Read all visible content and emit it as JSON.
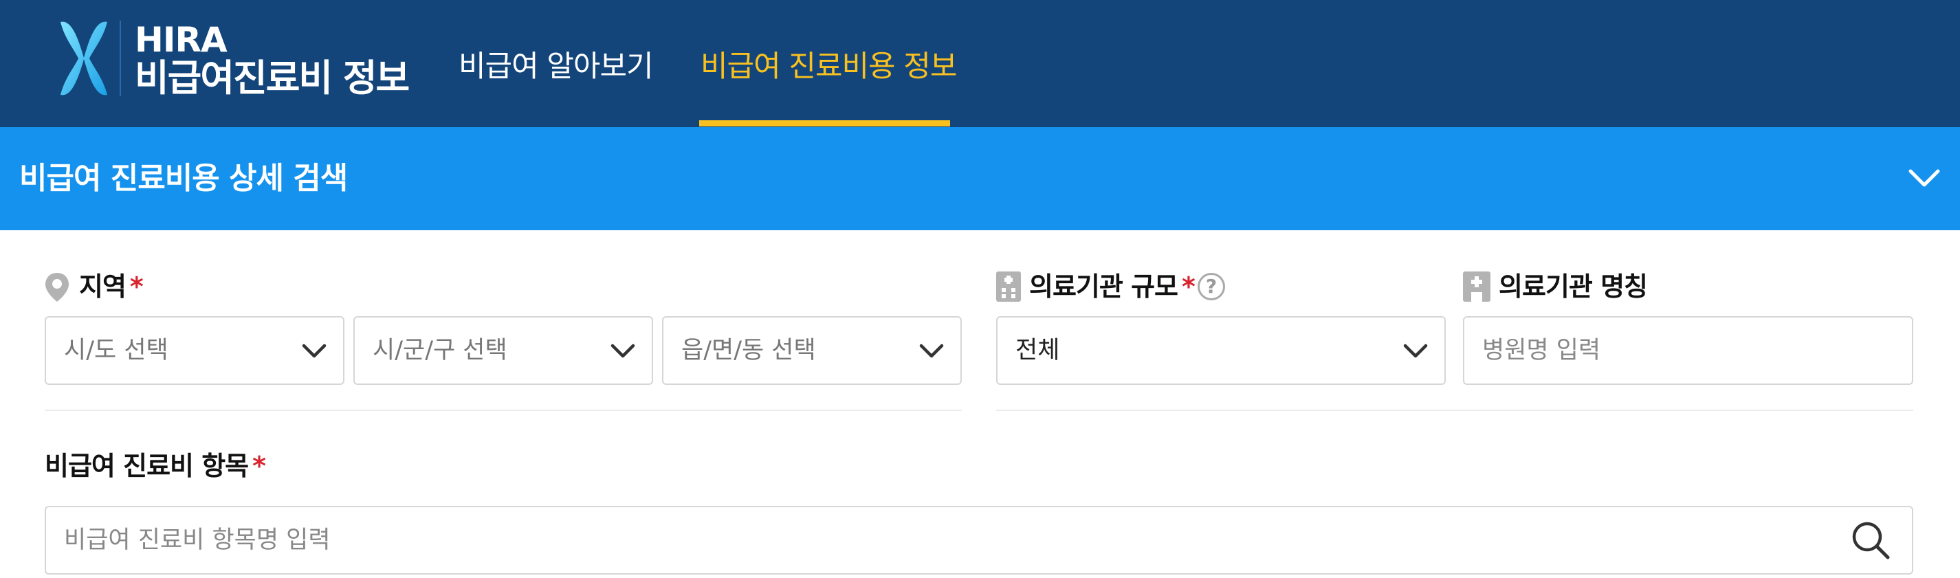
{
  "header": {
    "logo_title": "HIRA",
    "logo_subtitle": "비급여진료비 정보",
    "nav": [
      {
        "label": "비급여 알아보기",
        "active": false
      },
      {
        "label": "비급여 진료비용 정보",
        "active": true
      }
    ]
  },
  "search_panel": {
    "title": "비급여 진료비용 상세 검색",
    "toggle_icon": "chevron-down-icon"
  },
  "region": {
    "label": "지역",
    "required_mark": "*",
    "icon": "map-pin-icon",
    "selects": [
      {
        "selected": "시/도 선택"
      },
      {
        "selected": "시/군/구 선택"
      },
      {
        "selected": "읍/면/동 선택"
      }
    ]
  },
  "institution_scale": {
    "label": "의료기관 규모",
    "required_mark": "*",
    "icon": "hospital-building-icon",
    "help_icon": "help-icon",
    "help_glyph": "?",
    "selected": "전체"
  },
  "institution_name": {
    "label": "의료기관 명칭",
    "icon": "hospital-cross-icon",
    "placeholder": "병원명 입력",
    "value": ""
  },
  "item": {
    "label": "비급여 진료비 항목",
    "required_mark": "*",
    "placeholder": "비급여 진료비 항목명 입력",
    "value": "",
    "search_icon": "search-icon"
  },
  "colors": {
    "header_bg": "#13457a",
    "accent_yellow": "#f9c11f",
    "search_bar_bg": "#1592ee",
    "required_red": "#d9232e"
  }
}
